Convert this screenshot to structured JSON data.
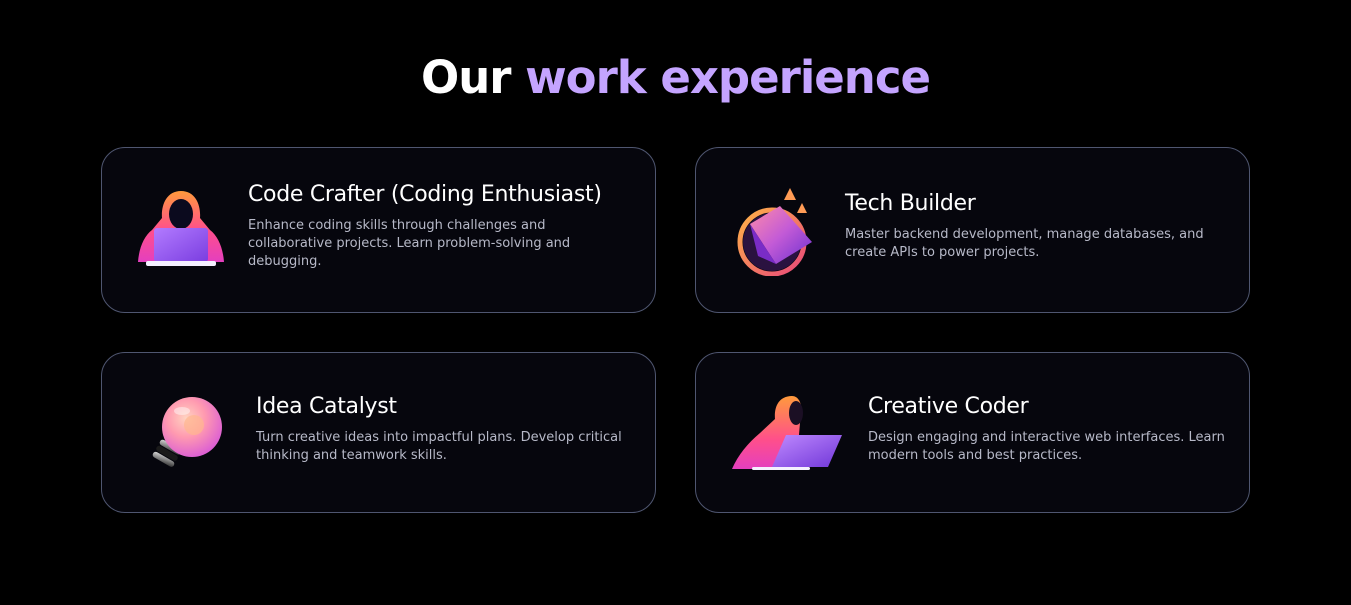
{
  "heading": {
    "part1": "Our",
    "part2": "work experience"
  },
  "colors": {
    "background": "#000000",
    "accent": "#c4a4ff",
    "card_border": "#4f5670",
    "card_background": "#06060d",
    "description": "#b7b9c8"
  },
  "cards": [
    {
      "icon": "hooded-coder-icon",
      "title": "Code Crafter (Coding Enthusiast)",
      "description": "Enhance coding skills through challenges and collaborative projects. Learn problem-solving and debugging."
    },
    {
      "icon": "growth-cube-icon",
      "title": "Tech Builder",
      "description": "Master backend development, manage databases, and create APIs to power projects."
    },
    {
      "icon": "lightbulb-icon",
      "title": "Idea Catalyst",
      "description": "Turn creative ideas into impactful plans. Develop critical thinking and teamwork skills."
    },
    {
      "icon": "laptop-coder-icon",
      "title": "Creative Coder",
      "description": "Design engaging and interactive web interfaces. Learn modern tools and best practices."
    }
  ]
}
